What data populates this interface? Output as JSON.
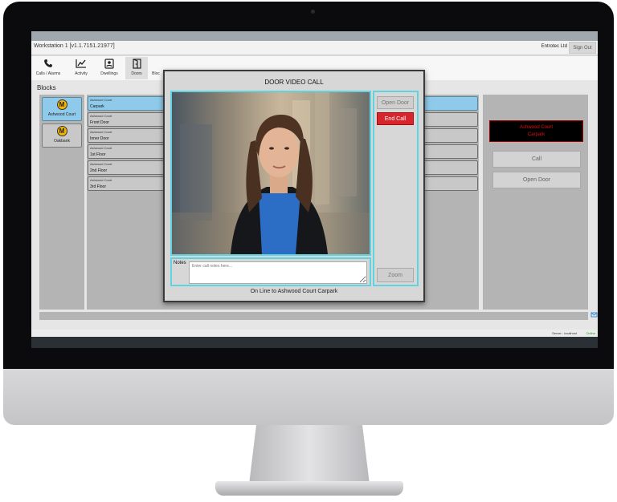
{
  "window": {
    "title": "Workstation 1 [v1.1.7151.21977]",
    "company": "Entrotec Ltd",
    "sign_out": "Sign Out"
  },
  "toolbar": {
    "items": [
      {
        "label": "Calls / Alarms",
        "icon": "phone-icon"
      },
      {
        "label": "Activity",
        "icon": "activity-chart-icon"
      },
      {
        "label": "Dwellings",
        "icon": "dwellings-icon"
      },
      {
        "label": "Doors",
        "icon": "door-icon"
      },
      {
        "label": "Bloc",
        "icon": "building-icon"
      },
      {
        "label": "",
        "icon": "tag-icon"
      },
      {
        "label": "",
        "icon": "database-icon"
      }
    ],
    "active": "Doors"
  },
  "blocks": {
    "title": "Blocks",
    "items": [
      {
        "name": "Ashwood Court",
        "logo": "M",
        "selected": true
      },
      {
        "name": "Oakbank",
        "logo": "M",
        "selected": false
      }
    ]
  },
  "doors": {
    "items": [
      {
        "block": "Ashwood Court",
        "name": "Carpark",
        "selected": true
      },
      {
        "block": "Ashwood Court",
        "name": "Front Door",
        "selected": false
      },
      {
        "block": "Ashwood Court",
        "name": "Inner Door",
        "selected": false
      },
      {
        "block": "Ashwood Court",
        "name": "1st Floor",
        "selected": false
      },
      {
        "block": "Ashwood Court",
        "name": "2nd Floor",
        "selected": false
      },
      {
        "block": "Ashwood Court",
        "name": "3rd Floor",
        "selected": false
      }
    ]
  },
  "right_panel": {
    "status_line1": "Ashwood Court",
    "status_line2": "Carpark",
    "call_button": "Call",
    "open_door_button": "Open Door"
  },
  "dialog": {
    "title": "DOOR VIDEO CALL",
    "notes_label": "Notes",
    "notes_placeholder": "Enter call notes here...",
    "open_door": "Open Door",
    "end_call": "End Call",
    "zoom": "Zoom",
    "status": "On Line to Ashwood Court Carpark"
  },
  "footer": {
    "server": "Server : localhost",
    "online": "Online"
  },
  "colors": {
    "accent": "#5fd4e0",
    "selected": "#8fcaea",
    "end_call": "#d8242c",
    "alert_text": "#e01010"
  }
}
